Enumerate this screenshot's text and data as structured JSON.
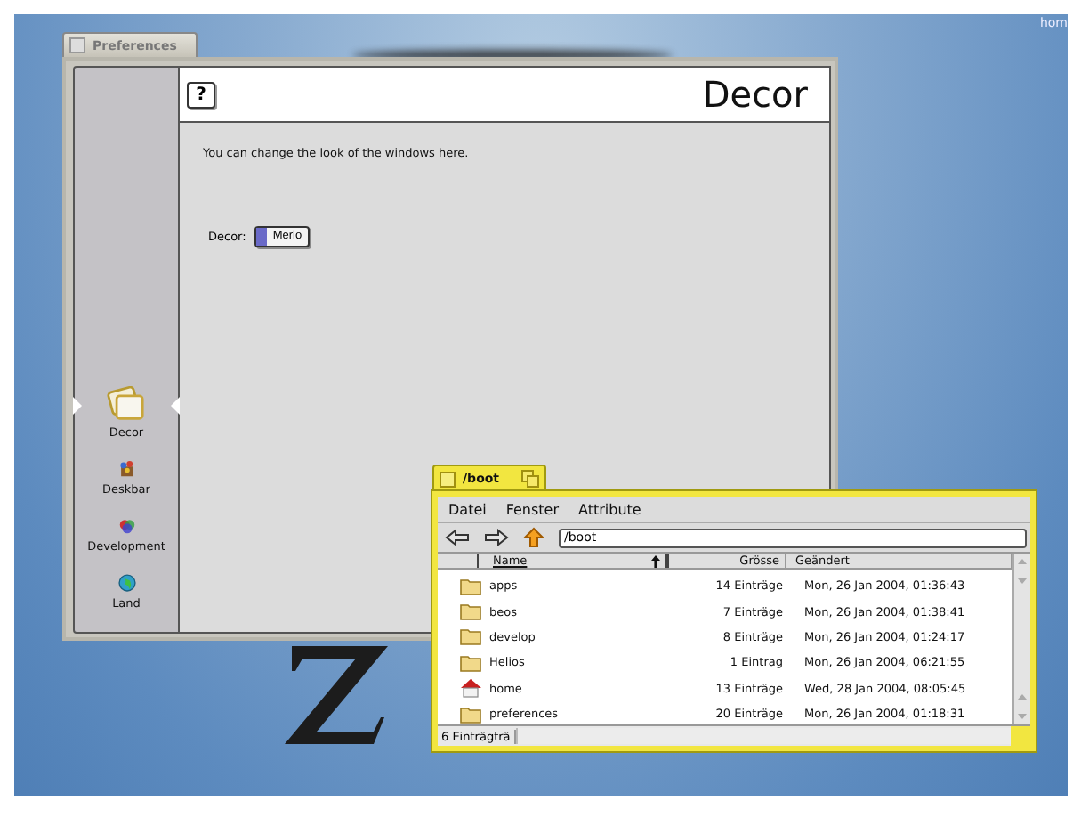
{
  "desktop": {
    "label": "hom"
  },
  "preferences": {
    "title": "Preferences",
    "help_button": "?",
    "header_title": "Decor",
    "description": "You can change the look of the windows here.",
    "decor_label": "Decor:",
    "decor_value": "Merlo",
    "sidebar": [
      {
        "label": "Decor",
        "selected": true
      },
      {
        "label": "Deskbar",
        "selected": false
      },
      {
        "label": "Development",
        "selected": false
      },
      {
        "label": "Land",
        "selected": false
      }
    ]
  },
  "tracker": {
    "title": "/boot",
    "menu": [
      "Datei",
      "Fenster",
      "Attribute"
    ],
    "path": "/boot",
    "columns": [
      "Name",
      "Grösse",
      "Geändert"
    ],
    "rows": [
      {
        "name": "apps",
        "size": "14 Einträge",
        "modified": "Mon, 26 Jan 2004, 01:36:43",
        "kind": "folder"
      },
      {
        "name": "beos",
        "size": "7 Einträge",
        "modified": "Mon, 26 Jan 2004, 01:38:41",
        "kind": "folder"
      },
      {
        "name": "develop",
        "size": "8 Einträge",
        "modified": "Mon, 26 Jan 2004, 01:24:17",
        "kind": "folder"
      },
      {
        "name": "Helios",
        "size": "1 Eintrag",
        "modified": "Mon, 26 Jan 2004, 06:21:55",
        "kind": "folder"
      },
      {
        "name": "home",
        "size": "13 Einträge",
        "modified": "Wed, 28 Jan 2004, 08:05:45",
        "kind": "home"
      },
      {
        "name": "preferences",
        "size": "20 Einträge",
        "modified": "Mon, 26 Jan 2004, 01:18:31",
        "kind": "folder"
      }
    ],
    "status": "6 Einträgträ"
  }
}
